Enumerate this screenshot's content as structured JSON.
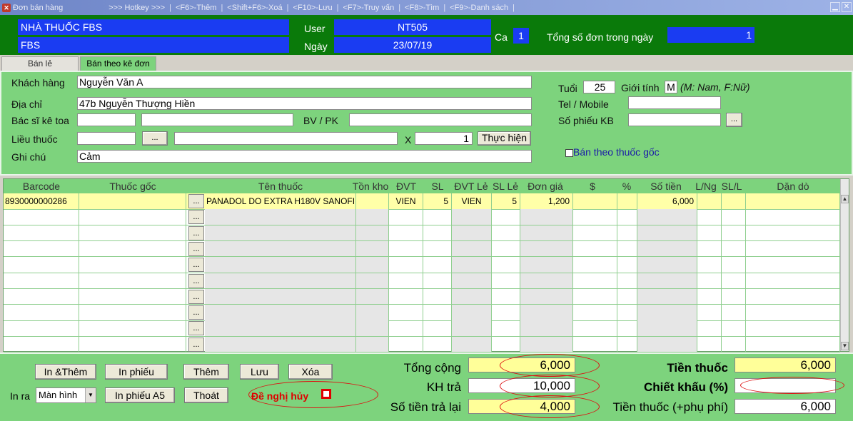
{
  "titlebar": {
    "app_title": "Đơn bán hàng",
    "hotkey": ">>> Hotkey >>>",
    "hk_add": "<F6>-Thêm",
    "hk_del": "<Shift+F6>-Xoá",
    "hk_save": "<F10>-Lưu",
    "hk_query": "<F7>-Truy vấn",
    "hk_find": "<F8>-Tìm",
    "hk_list": "<F9>-Danh sách",
    "sep": "|"
  },
  "header": {
    "store_name": "NHÀ THUỐC FBS",
    "store_short": "FBS",
    "user_label": "User",
    "user_value": "NT505",
    "date_label": "Ngày",
    "date_value": "23/07/19",
    "shift_label": "Ca",
    "shift_value": "1",
    "total_orders_label": "Tổng số đơn trong ngày",
    "total_orders_value": "1"
  },
  "tabs": [
    {
      "label": "Bán lẻ"
    },
    {
      "label": "Bán theo kê đơn"
    }
  ],
  "form": {
    "customer_label": "Khách hàng",
    "customer_value": "Nguyễn Văn A",
    "address_label": "Địa chỉ",
    "address_value": "47b Nguyễn Thượng Hiền",
    "doctor_label": "Bác sĩ kê toa",
    "bvpk_label": "BV / PK",
    "dosage_label": "Liều thuốc",
    "dots": "...",
    "x_label": "X",
    "qty_value": "1",
    "execute_label": "Thực hiện",
    "note_label": "Ghi chú",
    "note_value": "Cảm",
    "age_label": "Tuổi",
    "age_value": "25",
    "gender_label": "Giới tính",
    "gender_value": "M",
    "gender_hint": "(M: Nam, F:Nữ)",
    "tel_label": "Tel / Mobile",
    "kb_label": "Số phiếu KB",
    "original_drug_label": "Bán theo thuốc gốc"
  },
  "grid": {
    "columns": [
      "Barcode",
      "Thuốc gốc",
      "Tên thuốc",
      "Tồn kho",
      "ĐVT",
      "SL",
      "ĐVT Lẻ",
      "SL Lẻ",
      "Đơn giá",
      "$",
      "%",
      "Số tiền",
      "L/Ng",
      "SL/L",
      "Dặn dò"
    ],
    "rows": [
      {
        "barcode": "8930000000286",
        "generic": "",
        "name": "PANADOL DO  EXTRA H180V SANOFI",
        "stock": "",
        "unit": "VIEN",
        "qty": "5",
        "unit_small": "VIEN",
        "qty_small": "5",
        "price": "1,200",
        "usd": "",
        "pct": "",
        "amount": "6,000",
        "lng": "",
        "sll": "",
        "note": ""
      }
    ],
    "dots": "..."
  },
  "bottom": {
    "btn_print_add": "In &Thêm",
    "btn_print_slip": "In phiếu",
    "btn_add": "Thêm",
    "btn_save": "Lưu",
    "btn_delete": "Xóa",
    "print_to_label": "In ra",
    "print_to_value": "Màn hình",
    "btn_print_a5": "In phiếu A5",
    "btn_exit": "Thoát",
    "cancel_request_label": "Đề nghị hủy",
    "total_label": "Tổng cộng",
    "total_value": "6,000",
    "paid_label": "KH trả",
    "paid_value": "10,000",
    "change_label": "Số tiền trả lại",
    "change_value": "4,000",
    "drug_money_label": "Tiền thuốc",
    "drug_money_value": "6,000",
    "discount_label": "Chiết khấu (%)",
    "discount_value": "",
    "drug_fee_label": "Tiền thuốc (+phụ phí)",
    "drug_fee_value": "6,000"
  },
  "colors": {
    "panel_green": "#7dd37d",
    "header_green": "#0a7a0a",
    "field_blue": "#1a3cf2",
    "highlight_yellow": "#ffff99",
    "annotation_red": "#dd1111"
  }
}
